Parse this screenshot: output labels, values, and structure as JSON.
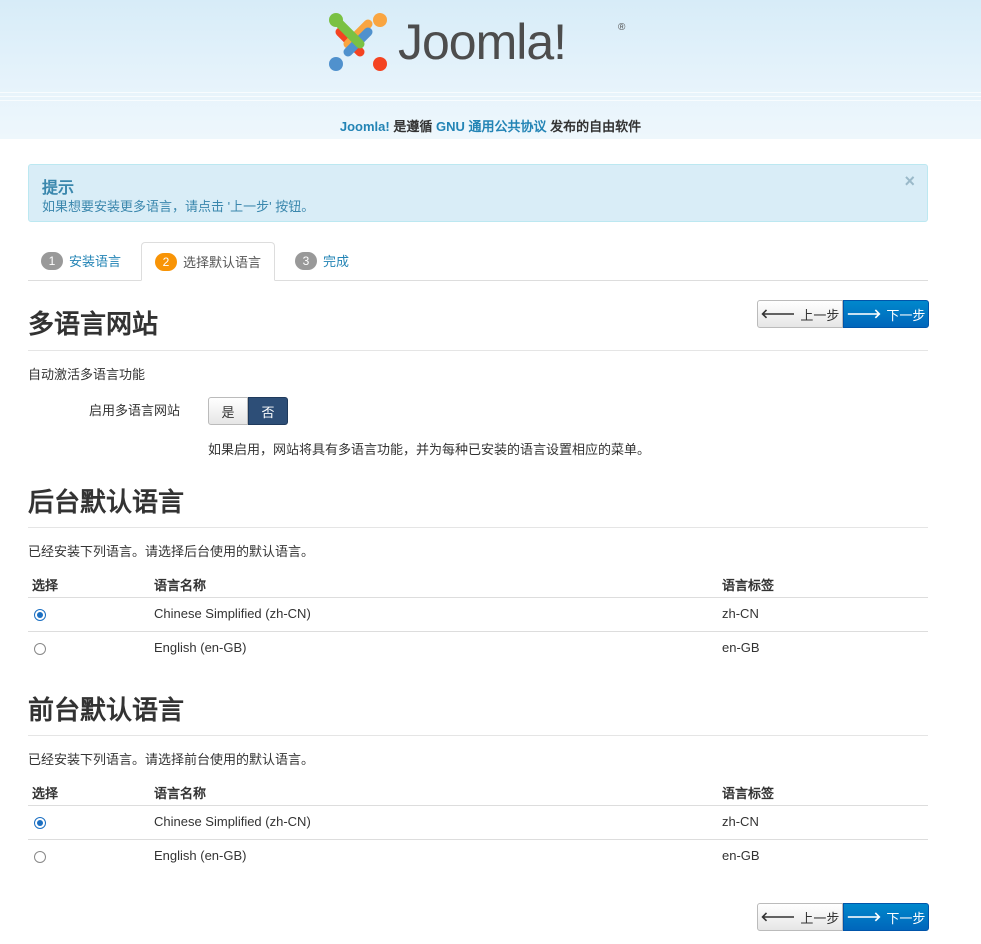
{
  "header": {
    "logo_text": "Joomla!",
    "logo_reg": "®",
    "tagline": {
      "brand": "Joomla!",
      "part1": " 是遵循 ",
      "license": "GNU 通用公共协议",
      "part2": " 发布的自由软件"
    }
  },
  "alert": {
    "title": "提示",
    "message": "如果想要安装更多语言，请点击 '上一步' 按钮。",
    "close": "×"
  },
  "tabs": [
    {
      "num": "1",
      "label": "安装语言"
    },
    {
      "num": "2",
      "label": "选择默认语言"
    },
    {
      "num": "3",
      "label": "完成"
    }
  ],
  "nav": {
    "prev_label": "上一步",
    "next_label": "下一步",
    "prev_icon": "arrow-left-icon",
    "next_icon": "arrow-right-icon"
  },
  "multilang": {
    "title": "多语言网站",
    "subtitle": "自动激活多语言功能",
    "field_label": "启用多语言网站",
    "yes": "是",
    "no": "否",
    "selected": "否",
    "help": "如果启用，网站将具有多语言功能，并为每种已安装的语言设置相应的菜单。"
  },
  "admin_lang": {
    "title": "后台默认语言",
    "desc": "已经安装下列语言。请选择后台使用的默认语言。",
    "columns": [
      "选择",
      "语言名称",
      "语言标签"
    ],
    "rows": [
      {
        "selected": true,
        "name": "Chinese Simplified (zh-CN)",
        "tag": "zh-CN"
      },
      {
        "selected": false,
        "name": "English (en-GB)",
        "tag": "en-GB"
      }
    ]
  },
  "site_lang": {
    "title": "前台默认语言",
    "desc": "已经安装下列语言。请选择前台使用的默认语言。",
    "columns": [
      "选择",
      "语言名称",
      "语言标签"
    ],
    "rows": [
      {
        "selected": true,
        "name": "Chinese Simplified (zh-CN)",
        "tag": "zh-CN"
      },
      {
        "selected": false,
        "name": "English (en-GB)",
        "tag": "en-GB"
      }
    ]
  },
  "colors": {
    "link": "#2384b5",
    "primary": "#0077cc",
    "active_tab_badge": "#f89406",
    "alert_bg": "#d9edf7",
    "toggle_on": "#2d4e77"
  }
}
